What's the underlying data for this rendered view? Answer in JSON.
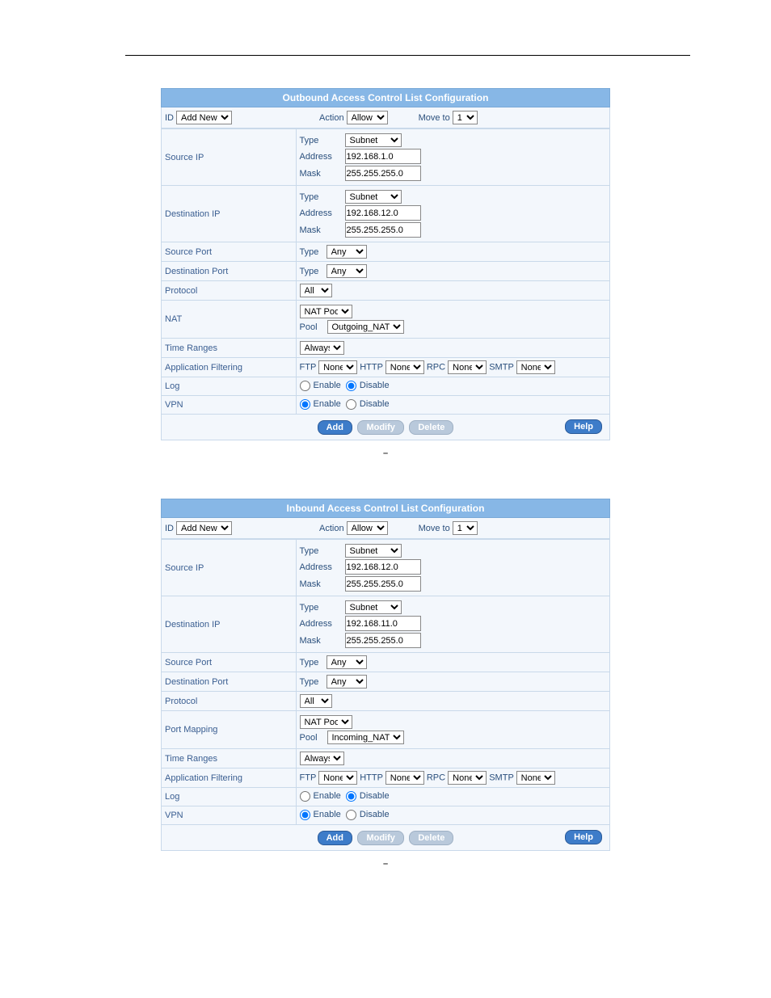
{
  "outbound": {
    "title": "Outbound Access Control List Configuration",
    "top": {
      "id_label": "ID",
      "id_value": "Add New",
      "action_label": "Action",
      "action_value": "Allow",
      "moveto_label": "Move to",
      "moveto_value": "1"
    },
    "sourceip": {
      "label": "Source IP",
      "type_label": "Type",
      "type_value": "Subnet",
      "addr_label": "Address",
      "addr_value": "192.168.1.0",
      "mask_label": "Mask",
      "mask_value": "255.255.255.0"
    },
    "destip": {
      "label": "Destination IP",
      "type_label": "Type",
      "type_value": "Subnet",
      "addr_label": "Address",
      "addr_value": "192.168.12.0",
      "mask_label": "Mask",
      "mask_value": "255.255.255.0"
    },
    "srcport": {
      "label": "Source Port",
      "type_label": "Type",
      "value": "Any"
    },
    "dstport": {
      "label": "Destination Port",
      "type_label": "Type",
      "value": "Any"
    },
    "protocol": {
      "label": "Protocol",
      "value": "All"
    },
    "nat": {
      "label": "NAT",
      "line1_value": "NAT Pool",
      "pool_label": "Pool",
      "pool_value": "Outgoing_NAT"
    },
    "timeranges": {
      "label": "Time Ranges",
      "value": "Always"
    },
    "appfilter": {
      "label": "Application Filtering",
      "ftp_label": "FTP",
      "ftp_value": "None",
      "http_label": "HTTP",
      "http_value": "None",
      "rpc_label": "RPC",
      "rpc_value": "None",
      "smtp_label": "SMTP",
      "smtp_value": "None"
    },
    "log": {
      "label": "Log",
      "enable": "Enable",
      "disable": "Disable"
    },
    "vpn": {
      "label": "VPN",
      "enable": "Enable",
      "disable": "Disable"
    },
    "buttons": {
      "add": "Add",
      "modify": "Modify",
      "delete": "Delete",
      "help": "Help"
    }
  },
  "inbound": {
    "title": "Inbound Access Control List Configuration",
    "top": {
      "id_label": "ID",
      "id_value": "Add New",
      "action_label": "Action",
      "action_value": "Allow",
      "moveto_label": "Move to",
      "moveto_value": "1"
    },
    "sourceip": {
      "label": "Source IP",
      "type_label": "Type",
      "type_value": "Subnet",
      "addr_label": "Address",
      "addr_value": "192.168.12.0",
      "mask_label": "Mask",
      "mask_value": "255.255.255.0"
    },
    "destip": {
      "label": "Destination IP",
      "type_label": "Type",
      "type_value": "Subnet",
      "addr_label": "Address",
      "addr_value": "192.168.11.0",
      "mask_label": "Mask",
      "mask_value": "255.255.255.0"
    },
    "srcport": {
      "label": "Source Port",
      "type_label": "Type",
      "value": "Any"
    },
    "dstport": {
      "label": "Destination Port",
      "type_label": "Type",
      "value": "Any"
    },
    "protocol": {
      "label": "Protocol",
      "value": "All"
    },
    "portmap": {
      "label": "Port Mapping",
      "line1_value": "NAT Pool",
      "pool_label": "Pool",
      "pool_value": "Incoming_NAT"
    },
    "timeranges": {
      "label": "Time Ranges",
      "value": "Always"
    },
    "appfilter": {
      "label": "Application Filtering",
      "ftp_label": "FTP",
      "ftp_value": "None",
      "http_label": "HTTP",
      "http_value": "None",
      "rpc_label": "RPC",
      "rpc_value": "None",
      "smtp_label": "SMTP",
      "smtp_value": "None"
    },
    "log": {
      "label": "Log",
      "enable": "Enable",
      "disable": "Disable"
    },
    "vpn": {
      "label": "VPN",
      "enable": "Enable",
      "disable": "Disable"
    },
    "buttons": {
      "add": "Add",
      "modify": "Modify",
      "delete": "Delete",
      "help": "Help"
    }
  },
  "caption_dash": "–"
}
